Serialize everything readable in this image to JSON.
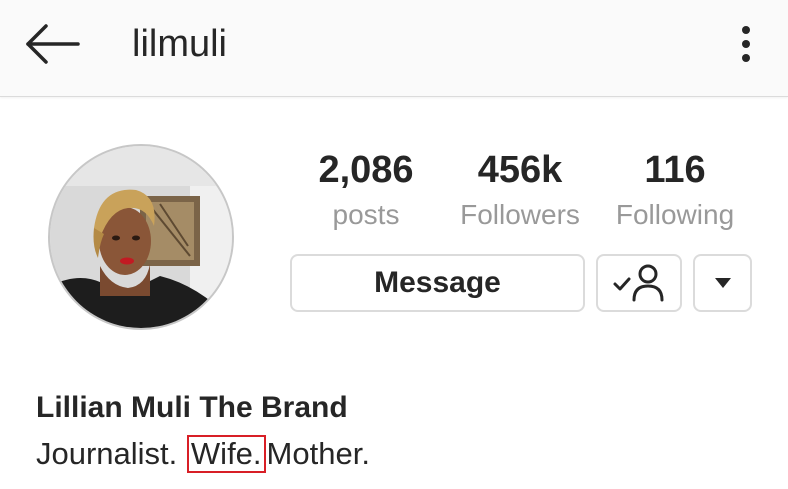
{
  "header": {
    "username": "lilmuli",
    "back_icon": "arrow-left-icon",
    "more_icon": "vertical-dots-icon"
  },
  "profile": {
    "avatar": "profile-photo",
    "stats": [
      {
        "value": "2,086",
        "label": "posts"
      },
      {
        "value": "456k",
        "label": "Followers"
      },
      {
        "value": "116",
        "label": "Following"
      }
    ],
    "message_label": "Message",
    "following_icon": "person-check-icon",
    "dropdown_icon": "triangle-down-icon"
  },
  "bio": {
    "full_name": "Lillian Muli The Brand",
    "part1": "Journalist.",
    "highlighted": "Wife.",
    "part3": "Mother.",
    "highlight_color": "#d81f26"
  }
}
